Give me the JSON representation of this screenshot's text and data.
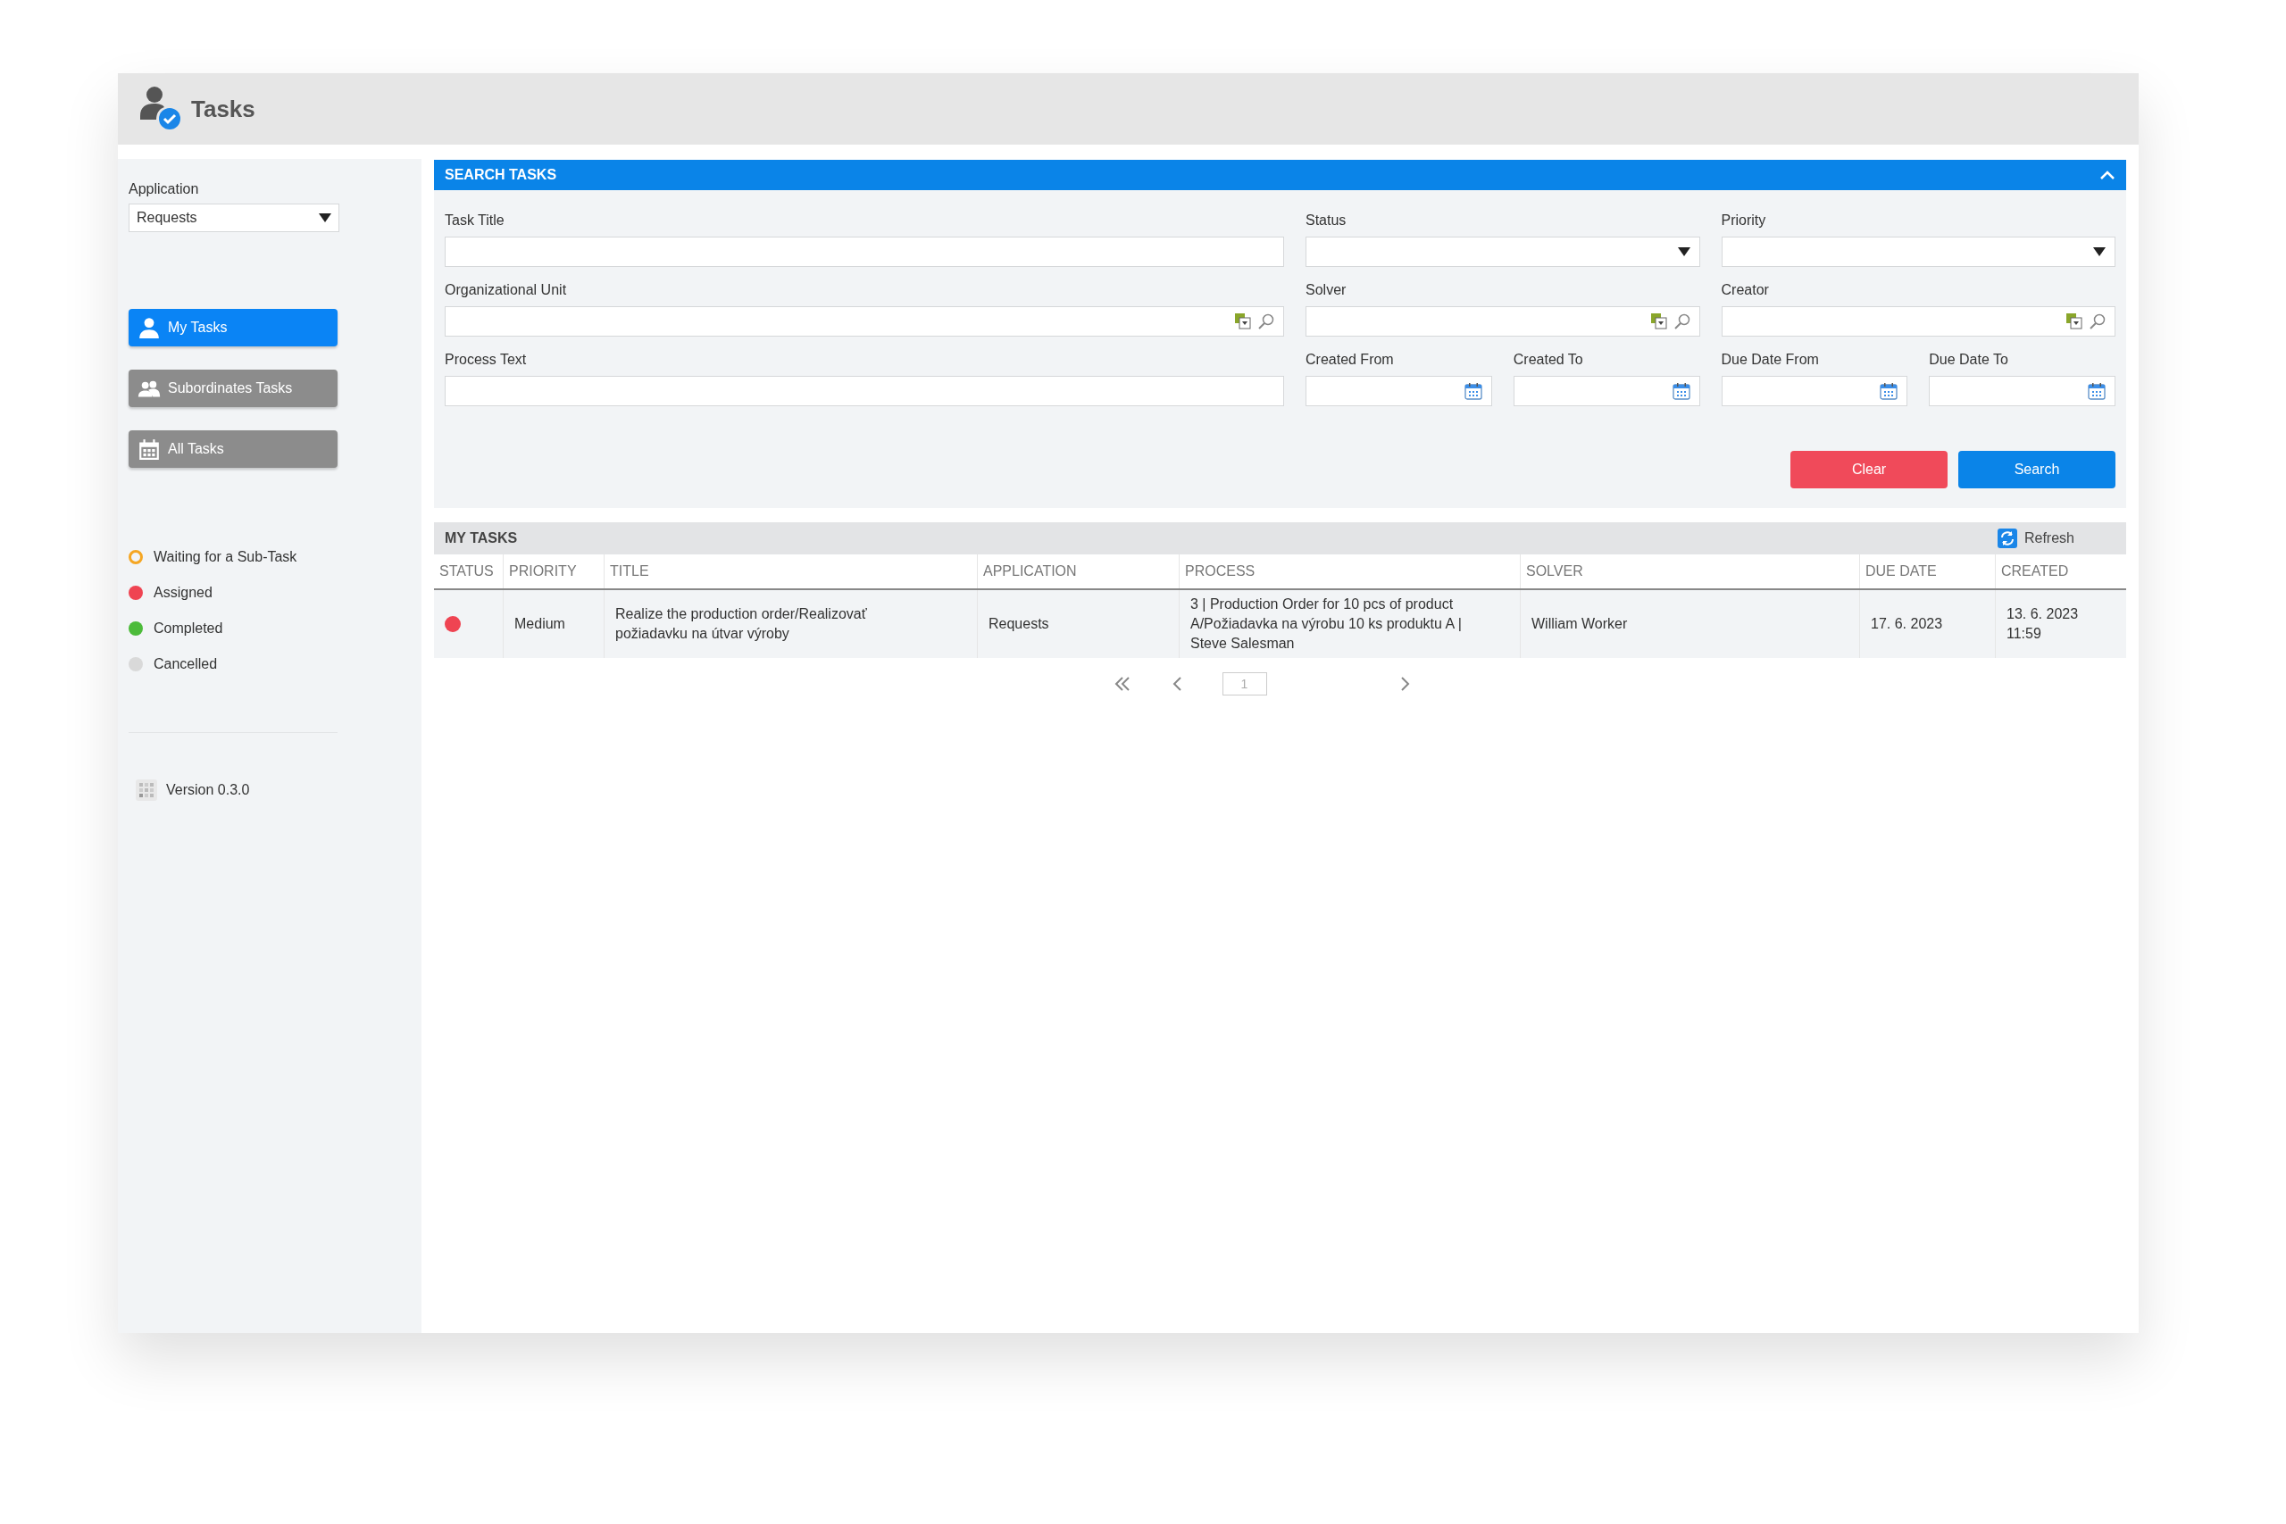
{
  "header": {
    "title": "Tasks"
  },
  "sidebar": {
    "application": {
      "label": "Application",
      "value": "Requests"
    },
    "nav": [
      {
        "label": "My Tasks",
        "selected": true
      },
      {
        "label": "Subordinates Tasks",
        "selected": false
      },
      {
        "label": "All Tasks",
        "selected": false
      }
    ],
    "legend": [
      {
        "label": "Waiting for a Sub-Task",
        "color": "#f5a623",
        "kind": "ring"
      },
      {
        "label": "Assigned",
        "color": "#ef4452",
        "kind": "dot"
      },
      {
        "label": "Completed",
        "color": "#4cbb3a",
        "kind": "dot"
      },
      {
        "label": "Cancelled",
        "color": "#d9d9d9",
        "kind": "dot"
      }
    ],
    "version": "Version 0.3.0"
  },
  "search": {
    "title": "SEARCH TASKS",
    "expanded": true,
    "fields": [
      {
        "label": "Task Title",
        "kind": "text"
      },
      {
        "label": "Status",
        "kind": "select"
      },
      {
        "label": "Priority",
        "kind": "select"
      },
      {
        "label": "Organizational Unit",
        "kind": "lookup"
      },
      {
        "label": "Solver",
        "kind": "lookup"
      },
      {
        "label": "Creator",
        "kind": "lookup"
      },
      {
        "label": "Process Text",
        "kind": "text"
      },
      {
        "label": "Created From",
        "kind": "date"
      },
      {
        "label": "Created To",
        "kind": "date"
      },
      {
        "label": "Due Date From",
        "kind": "date"
      },
      {
        "label": "Due Date To",
        "kind": "date"
      }
    ],
    "buttons": [
      {
        "label": "Clear",
        "kind": "danger"
      },
      {
        "label": "Search",
        "kind": "primary"
      }
    ]
  },
  "tasks": {
    "title": "MY TASKS",
    "refresh": "Refresh",
    "columns": [
      "STATUS",
      "PRIORITY",
      "TITLE",
      "APPLICATION",
      "PROCESS",
      "SOLVER",
      "DUE DATE",
      "CREATED"
    ],
    "rows": [
      {
        "color": "#ef4452",
        "cells": [
          "",
          "Medium",
          "Realize the production order/Realizovať požiadavku na útvar výroby",
          "Requests",
          "3 | Production Order for 10 pcs of product A/Požiadavka na výrobu 10 ks produktu A | Steve Salesman",
          "William Worker",
          "17. 6. 2023",
          "13. 6. 2023 11:59"
        ]
      }
    ]
  },
  "pagination": {
    "page": "1"
  }
}
